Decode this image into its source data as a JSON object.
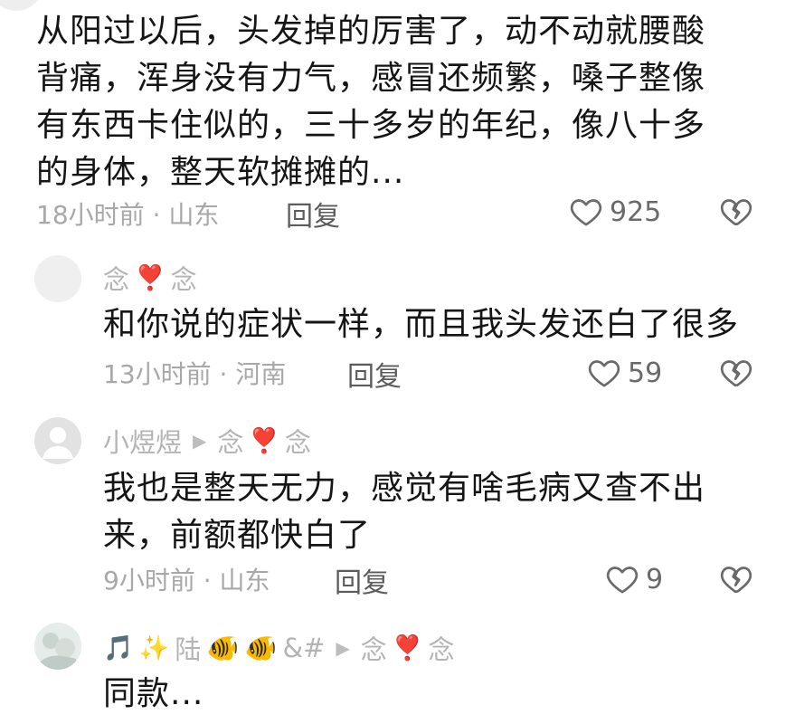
{
  "comments": [
    {
      "text_lines": [
        "从阳过以后，头发掉的厉害了，动不动就腰酸",
        "背痛，浑身没有力气，感冒还频繁，嗓子整像",
        "有东西卡住似的，三十多岁的年纪，像八十多",
        "的身体，整天软摊摊的..."
      ],
      "meta": "18小时前 · 山东",
      "reply_label": "回复",
      "likes": "925"
    },
    {
      "user": {
        "name_left": "念",
        "name_right": "念"
      },
      "text_lines": [
        "和你说的症状一样，而且我头发还白了很多"
      ],
      "meta": "13小时前 · 河南",
      "reply_label": "回复",
      "likes": "59"
    },
    {
      "user": {
        "name": "小煜煜",
        "reply_to_left": "念",
        "reply_to_right": "念"
      },
      "text_lines": [
        "我也是整天无力，感觉有啥毛病又查不出",
        "来，前额都快白了"
      ],
      "meta": "9小时前 · 山东",
      "reply_label": "回复",
      "likes": "9"
    },
    {
      "user": {
        "name": "陆",
        "name_suffix": "&#",
        "reply_to_left": "念",
        "reply_to_right": "念"
      },
      "text_lines": [
        "同款..."
      ]
    }
  ],
  "colors": {
    "text": "#151515",
    "meta": "#a8a8a8",
    "username": "#b4b4b4",
    "heart_red": "#e12a2a",
    "icon_gray": "#6a6a6a"
  },
  "icons": {
    "heart_symbol": "heart-emoji",
    "reply_arrow": "play-arrow-icon",
    "like": "heart-outline-icon",
    "dislike": "broken-heart-icon",
    "music": "music-note-emoji",
    "sparkles": "sparkles-emoji",
    "fish": "tropical-fish-emoji"
  }
}
